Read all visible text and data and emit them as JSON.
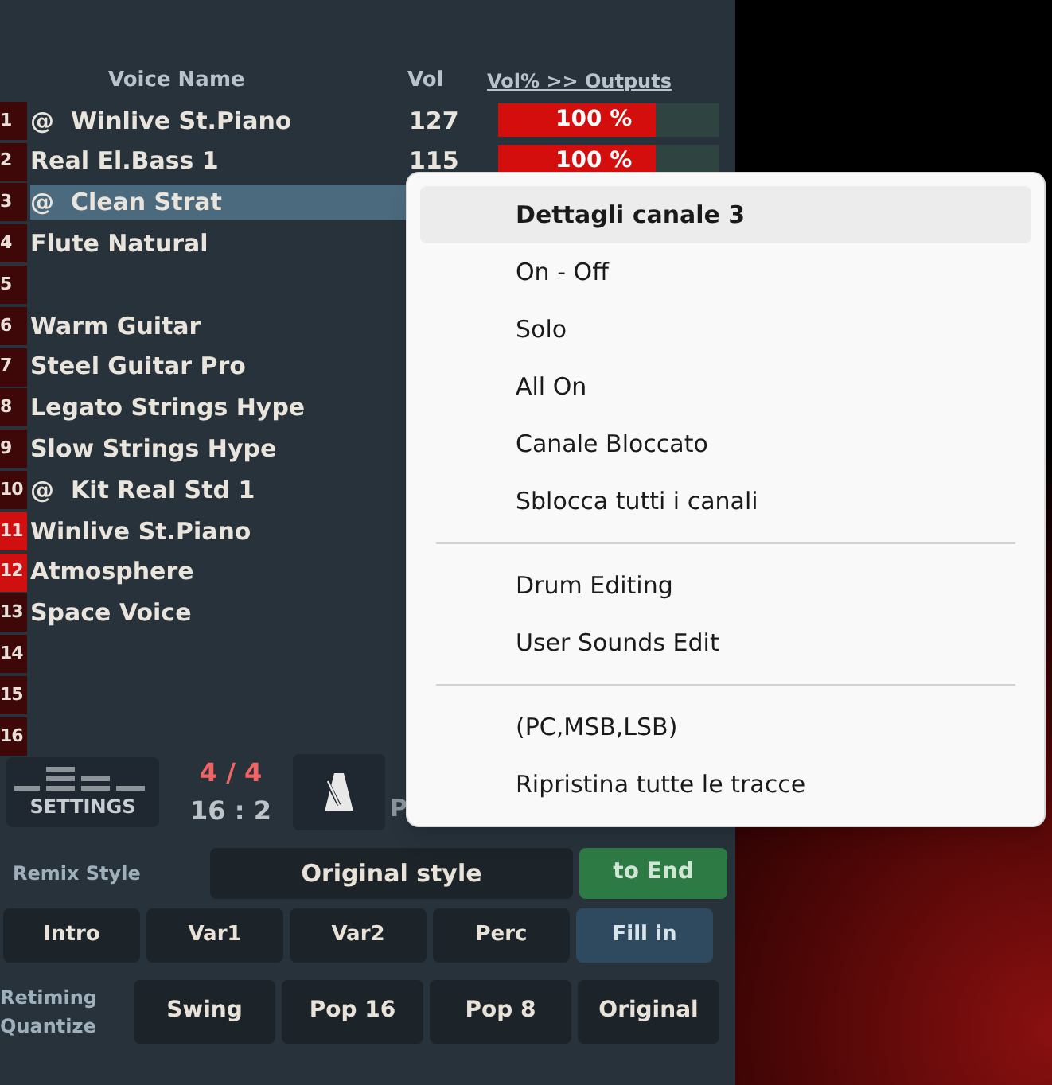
{
  "header": {
    "voice_name": "Voice Name",
    "vol": "Vol",
    "outputs": "Vol% >> Outputs"
  },
  "channels": [
    {
      "number": "1",
      "name": "@  Winlive St.Piano",
      "vol": "127",
      "output": "100 %",
      "level": 0.71,
      "selected": false,
      "active": false
    },
    {
      "number": "2",
      "name": "Real El.Bass 1",
      "vol": "115",
      "output": "100 %",
      "level": 0.71,
      "selected": false,
      "active": false
    },
    {
      "number": "3",
      "name": "@  Clean Strat",
      "selected": true,
      "active": false
    },
    {
      "number": "4",
      "name": "Flute Natural",
      "selected": false,
      "active": false
    },
    {
      "number": "5",
      "selected": false,
      "active": false
    },
    {
      "number": "6",
      "name": "Warm Guitar",
      "selected": false,
      "active": false
    },
    {
      "number": "7",
      "name": "Steel Guitar Pro",
      "selected": false,
      "active": false
    },
    {
      "number": "8",
      "name": "Legato Strings Hype",
      "selected": false,
      "active": false
    },
    {
      "number": "9",
      "name": "Slow Strings Hype",
      "selected": false,
      "active": false
    },
    {
      "number": "10",
      "name": "@  Kit Real Std 1",
      "selected": false,
      "active": false
    },
    {
      "number": "11",
      "name": "Winlive St.Piano",
      "selected": false,
      "active": true
    },
    {
      "number": "12",
      "name": "Atmosphere",
      "selected": false,
      "active": true
    },
    {
      "number": "13",
      "name": "Space Voice",
      "selected": false,
      "active": false
    },
    {
      "number": "14",
      "selected": false,
      "active": false
    },
    {
      "number": "15",
      "selected": false,
      "active": false
    },
    {
      "number": "16",
      "selected": false,
      "active": false
    }
  ],
  "settings_button": "SETTINGS",
  "time_signature": "4 / 4",
  "position": "16 : 2",
  "cut_label": "P",
  "remix": {
    "label": "Remix Style",
    "value": "Original style",
    "end_button": "to End"
  },
  "sections": [
    {
      "label": "Intro",
      "selected": false
    },
    {
      "label": "Var1",
      "selected": false
    },
    {
      "label": "Var2",
      "selected": false
    },
    {
      "label": "Perc",
      "selected": false
    },
    {
      "label": "Fill in",
      "selected": true
    }
  ],
  "retiming": {
    "label_lines": [
      "Retiming",
      "Quantize"
    ],
    "options": [
      {
        "label": "Swing",
        "selected": false
      },
      {
        "label": "Pop 16",
        "selected": false
      },
      {
        "label": "Pop 8",
        "selected": false
      },
      {
        "label": "Original",
        "selected": false
      }
    ]
  },
  "context_menu": [
    {
      "kind": "item",
      "label": "Dettagli canale 3",
      "selected": true
    },
    {
      "kind": "item",
      "label": "On - Off",
      "selected": false
    },
    {
      "kind": "item",
      "label": "Solo",
      "selected": false
    },
    {
      "kind": "item",
      "label": "All On",
      "selected": false
    },
    {
      "kind": "item",
      "label": "Canale Bloccato",
      "selected": false
    },
    {
      "kind": "item",
      "label": "Sblocca tutti i canali",
      "selected": false
    },
    {
      "kind": "separator"
    },
    {
      "kind": "item",
      "label": "Drum Editing",
      "selected": false
    },
    {
      "kind": "item",
      "label": "User Sounds Edit",
      "selected": false
    },
    {
      "kind": "separator"
    },
    {
      "kind": "item",
      "label": "(PC,MSB,LSB)",
      "selected": false
    },
    {
      "kind": "item",
      "label": "Ripristina tutte le tracce",
      "selected": false
    }
  ]
}
